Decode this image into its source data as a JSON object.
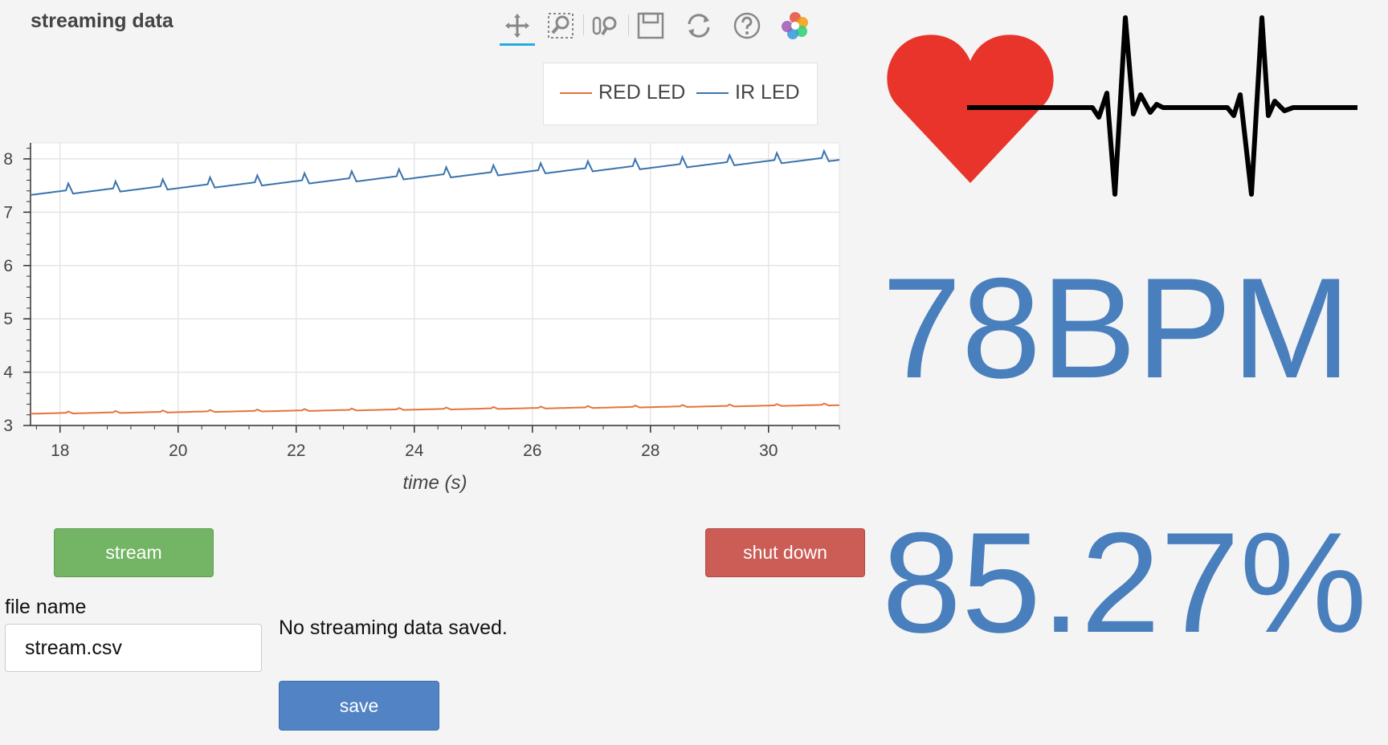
{
  "app": {
    "title": "streaming data"
  },
  "toolbar": {
    "tools": [
      "pan-icon",
      "box-zoom-icon",
      "wheel-zoom-icon",
      "save-plot-icon",
      "reset-icon",
      "help-icon",
      "bokeh-logo-icon"
    ]
  },
  "chart_data": {
    "type": "line",
    "title": "",
    "xlabel": "time (s)",
    "ylabel": "",
    "xlim": [
      17.5,
      31.2
    ],
    "ylim": [
      3,
      8.3
    ],
    "x_ticks": [
      18,
      20,
      22,
      24,
      26,
      28,
      30
    ],
    "y_ticks": [
      3,
      4,
      5,
      6,
      7,
      8
    ],
    "x_tick_labels": [
      "18",
      "20",
      "22",
      "24",
      "26",
      "28",
      "30"
    ],
    "y_tick_labels": [
      "3",
      "4",
      "5",
      "6",
      "7",
      "8"
    ],
    "legend_position": "top-right",
    "grid": true,
    "series": [
      {
        "name": "RED LED",
        "color": "#e5733c",
        "start": 3.23,
        "end": 3.39,
        "beat_amplitude": 0.025,
        "beat_period": 0.8
      },
      {
        "name": "IR LED",
        "color": "#3a73ad",
        "start": 7.38,
        "end": 8.03,
        "beat_amplitude": 0.13,
        "beat_period": 0.8
      }
    ]
  },
  "legend": {
    "red_label": "RED LED",
    "ir_label": "IR LED"
  },
  "controls": {
    "stream_label": "stream",
    "shutdown_label": "shut down",
    "save_label": "save",
    "file_label": "file name",
    "file_value": "stream.csv",
    "status": "No streaming data saved."
  },
  "readings": {
    "bpm": "78BPM",
    "spo2": "85.27%"
  },
  "colors": {
    "accent": "#4a7fbd",
    "stream": "#73b564",
    "shutdown": "#cb5c56",
    "save": "#5283c4",
    "heart": "#e8342a"
  }
}
